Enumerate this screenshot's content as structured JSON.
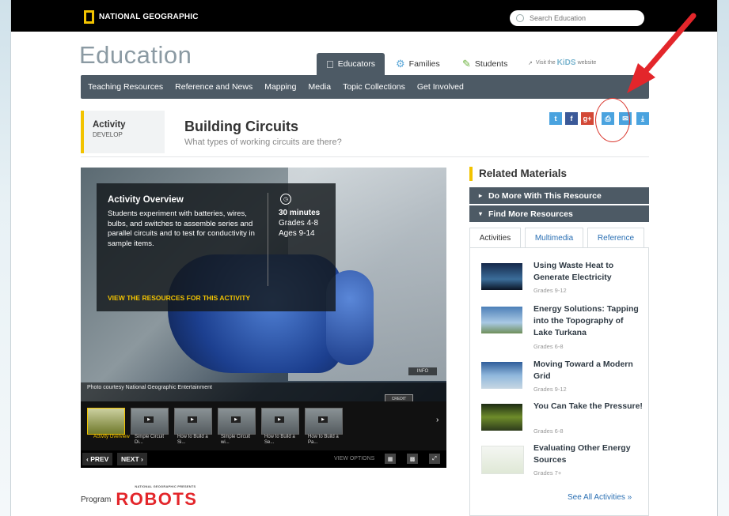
{
  "header": {
    "brand": "NATIONAL GEOGRAPHIC",
    "search_placeholder": "Search Education"
  },
  "site": {
    "title": "Education",
    "audience_tabs": [
      {
        "label": "Educators",
        "icon": "apple-icon",
        "active": true
      },
      {
        "label": "Families",
        "icon": "people-icon",
        "active": false
      },
      {
        "label": "Students",
        "icon": "pencil-icon",
        "active": false
      }
    ],
    "kids_prefix": "Visit the",
    "kids_brand": "KiDS",
    "kids_suffix": "website"
  },
  "nav": {
    "items": [
      "Teaching Resources",
      "Reference and News",
      "Mapping",
      "Media",
      "Topic Collections",
      "Get Involved"
    ]
  },
  "activity": {
    "type": "Activity",
    "stage": "DEVELOP",
    "title": "Building Circuits",
    "question": "What types of working circuits are there?"
  },
  "share": {
    "icons": [
      {
        "name": "twitter-icon",
        "glyph": "t",
        "color": "#4aa3df"
      },
      {
        "name": "facebook-icon",
        "glyph": "f",
        "color": "#3b5998"
      },
      {
        "name": "google-plus-icon",
        "glyph": "g+",
        "color": "#d34836"
      },
      {
        "name": "print-icon",
        "glyph": "⎙",
        "color": "#4aa3df"
      },
      {
        "name": "email-icon",
        "glyph": "✉",
        "color": "#4aa3df"
      },
      {
        "name": "download-icon",
        "glyph": "⤓",
        "color": "#4aa3df"
      }
    ]
  },
  "overview": {
    "heading": "Activity Overview",
    "description": "Students experiment with batteries, wires, bulbs, and switches to assemble series and parallel circuits and to test for conductivity in sample items.",
    "duration": "30 minutes",
    "grades": "Grades 4-8",
    "ages": "Ages 9-14",
    "link": "VIEW THE RESOURCES FOR THIS ACTIVITY",
    "info_label": "INFO",
    "photo_credit": "Photo courtesy National Geographic Entertainment",
    "credit_button": "CREDIT"
  },
  "thumbnails": [
    {
      "label": "Activity Overview",
      "active": true
    },
    {
      "label": "Simple Circuit Di...",
      "active": false
    },
    {
      "label": "How to Build a Si...",
      "active": false
    },
    {
      "label": "Simple Circuit wi...",
      "active": false
    },
    {
      "label": "How to Build a Se...",
      "active": false
    },
    {
      "label": "How to Build a Pa...",
      "active": false
    }
  ],
  "controls": {
    "prev": "‹ PREV",
    "next": "NEXT ›",
    "view_options": "VIEW OPTIONS"
  },
  "program": {
    "label": "Program",
    "name": "ROBOTS",
    "presents": "NATIONAL GEOGRAPHIC PRESENTS"
  },
  "related": {
    "heading": "Related Materials",
    "accordions": [
      {
        "label": "Do More With This Resource",
        "caret": "▸"
      },
      {
        "label": "Find More Resources",
        "caret": "▾"
      }
    ],
    "tabs": [
      {
        "label": "Activities",
        "active": true
      },
      {
        "label": "Multimedia",
        "active": false
      },
      {
        "label": "Reference",
        "active": false
      }
    ],
    "items": [
      {
        "title": "Using Waste Heat to Generate Electricity",
        "grades": "Grades 9-12"
      },
      {
        "title": "Energy Solutions: Tapping into the Topography of Lake Turkana",
        "grades": "Grades 6-8"
      },
      {
        "title": "Moving Toward a Modern Grid",
        "grades": "Grades 9-12"
      },
      {
        "title": "You Can Take the Pressure!",
        "grades": "Grades 6-8"
      },
      {
        "title": "Evaluating Other Energy Sources",
        "grades": "Grades 7+"
      }
    ],
    "see_all": "See All Activities »"
  }
}
